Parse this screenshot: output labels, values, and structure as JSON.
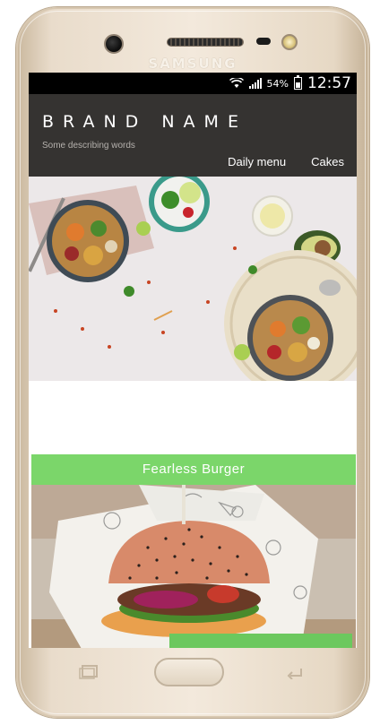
{
  "device": {
    "brand_label": "SAMSUNG"
  },
  "status_bar": {
    "battery_percent": "54%",
    "time": "12:57",
    "icons": [
      "wifi-icon",
      "signal-icon",
      "battery-icon"
    ]
  },
  "header": {
    "brand_name": "BRAND NAME",
    "tagline": "Some describing words",
    "nav_items": [
      {
        "label": "Daily menu"
      },
      {
        "label": "Cakes"
      }
    ]
  },
  "menu_card": {
    "title": "Fearless Burger"
  },
  "colors": {
    "header_bg": "#353331",
    "accent_green": "#7bd66a",
    "status_bar_bg": "#000000"
  }
}
